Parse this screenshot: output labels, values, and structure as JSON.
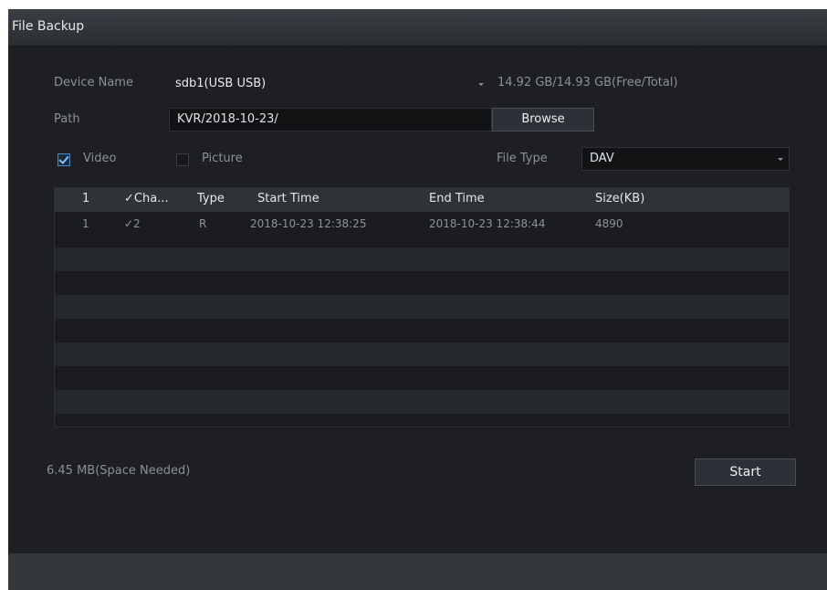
{
  "window": {
    "title": "File Backup"
  },
  "device": {
    "label": "Device Name",
    "value": "sdb1(USB USB)",
    "capacity": "14.92 GB/14.93 GB(Free/Total)"
  },
  "path": {
    "label": "Path",
    "value": "KVR/2018-10-23/",
    "browse_label": "Browse"
  },
  "filters": {
    "video_label": "Video",
    "video_checked": true,
    "picture_label": "Picture",
    "picture_checked": false,
    "file_type_label": "File Type",
    "file_type_value": "DAV"
  },
  "table": {
    "headers": [
      "1",
      "✓Cha...",
      "Type",
      "Start Time",
      "End Time",
      "Size(KB)"
    ],
    "rows": [
      [
        "1",
        "✓2",
        "R",
        "2018-10-23 12:38:25",
        "2018-10-23 12:38:44",
        "4890"
      ]
    ]
  },
  "footer": {
    "space_needed": "6.45 MB(Space Needed)",
    "start_label": "Start"
  },
  "colors": {
    "background": "#1d1f23",
    "header_row": "#2f3237",
    "accent_check": "#4b89c6"
  }
}
